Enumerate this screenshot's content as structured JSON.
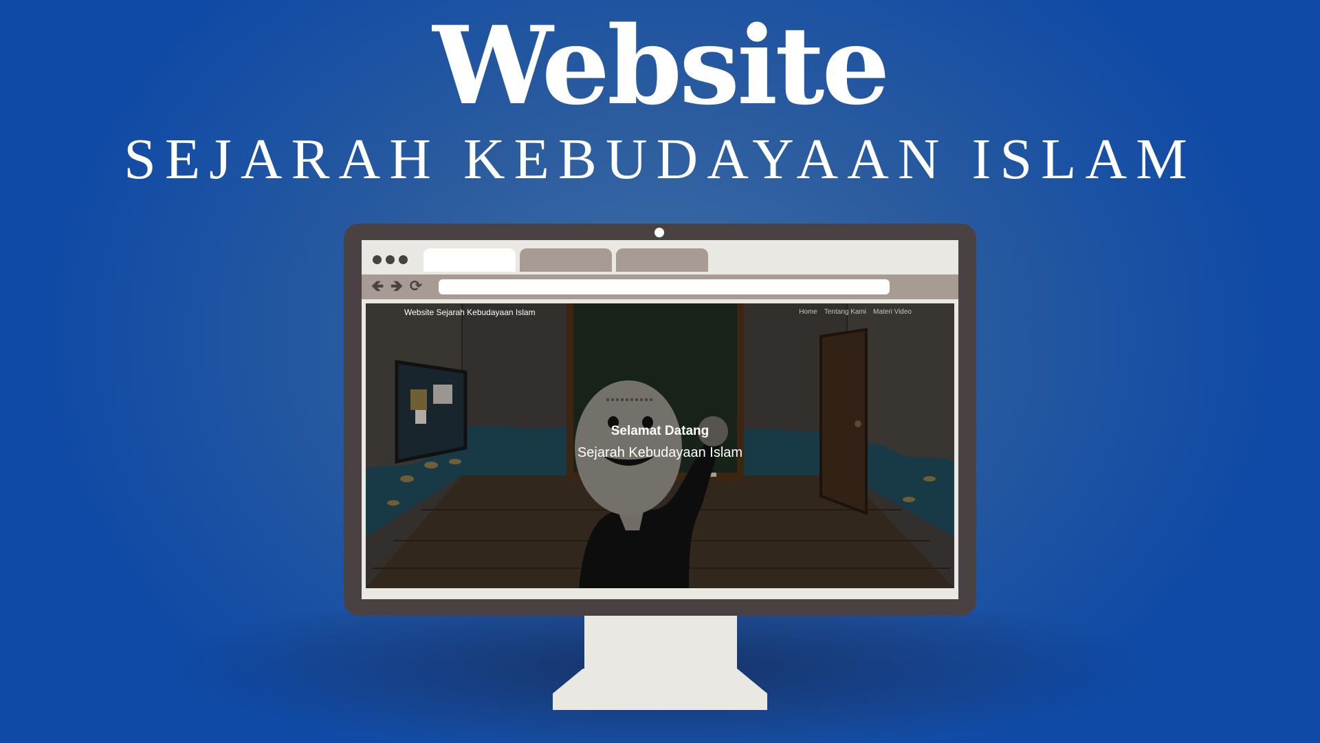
{
  "poster": {
    "headline": "Website",
    "subheadline": "SEJARAH KEBUDAYAAN ISLAM"
  },
  "browser": {
    "tabs": [
      {
        "label": "",
        "active": true
      },
      {
        "label": "",
        "active": false
      },
      {
        "label": "",
        "active": false
      }
    ],
    "address_value": "",
    "icons": [
      "back-arrow-icon",
      "forward-arrow-icon",
      "reload-icon"
    ]
  },
  "website": {
    "brand": "Website Sejarah Kebudayaan Islam",
    "nav": [
      "Home",
      "Tentang Kami",
      "Materi Video"
    ],
    "hero_title": "Selamat Datang",
    "hero_subtitle": "Sejarah Kebudayaan Islam"
  },
  "colors": {
    "background": "#0f4aa6",
    "monitor_frame": "#4a4242",
    "browser_chrome": "#a79b94",
    "chalkboard": "#1d2a1f"
  }
}
